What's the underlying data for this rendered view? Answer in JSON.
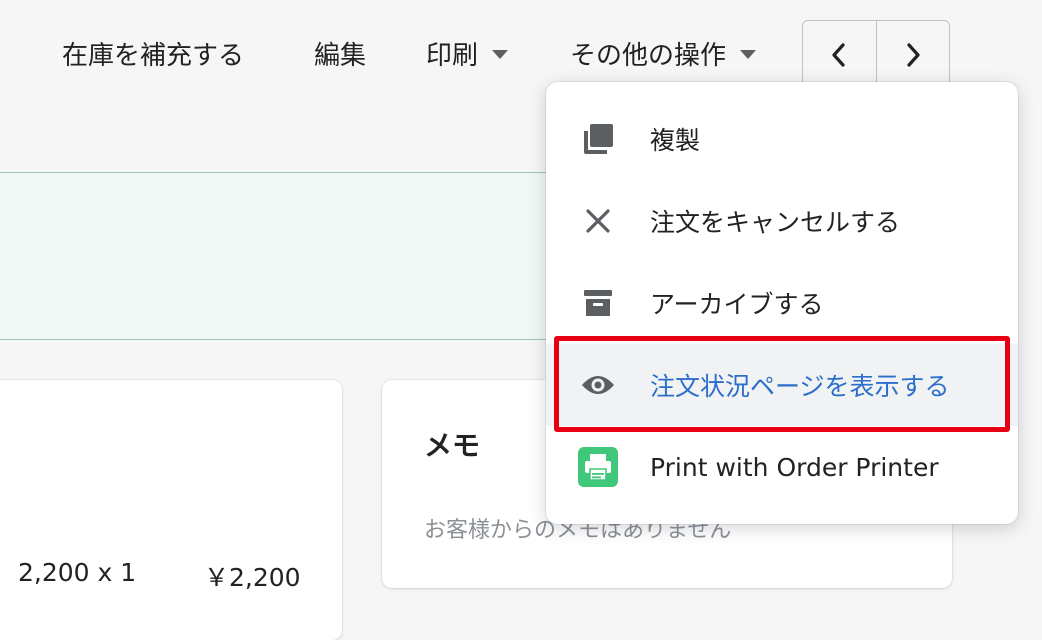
{
  "toolbar": {
    "restock_label": "在庫を補充する",
    "edit_label": "編集",
    "print_label": "印刷",
    "more_actions_label": "その他の操作"
  },
  "pager": {
    "prev_icon": "chevron-left-icon",
    "next_icon": "chevron-right-icon"
  },
  "order_card": {
    "line_qty": "2,200 x 1",
    "line_total": "￥2,200"
  },
  "memo_card": {
    "title": "メモ",
    "empty_text": "お客様からのメモはありません"
  },
  "more_actions_menu": {
    "items": [
      {
        "label": "複製",
        "icon": "duplicate-icon"
      },
      {
        "label": "注文をキャンセルする",
        "icon": "close-icon"
      },
      {
        "label": "アーカイブする",
        "icon": "archive-icon"
      },
      {
        "label": "注文状況ページを表示する",
        "icon": "eye-icon",
        "highlighted": true
      },
      {
        "label": "Print with Order Printer",
        "icon": "printer-app-icon"
      }
    ]
  },
  "colors": {
    "highlight_outline": "#e60012",
    "link_blue": "#2c6ecb",
    "banner_border": "#95c9b4",
    "banner_bg": "#f1f8f5",
    "printer_app_green": "#3fc77a"
  }
}
